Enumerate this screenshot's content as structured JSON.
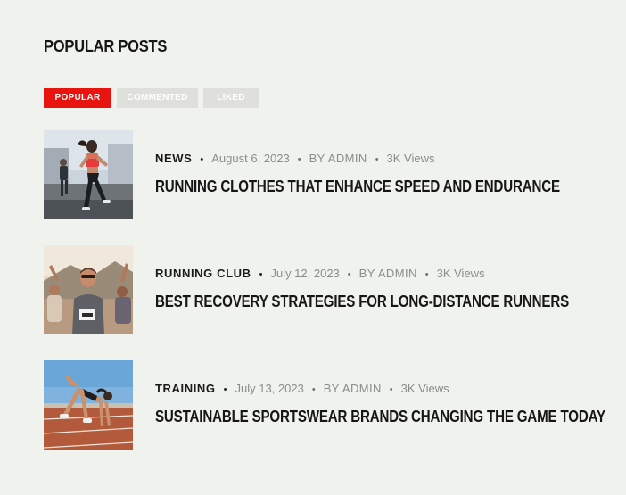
{
  "widget": {
    "title": "POPULAR POSTS"
  },
  "tabs": [
    {
      "label": "POPULAR",
      "active": true
    },
    {
      "label": "COMMENTED",
      "active": false
    },
    {
      "label": "LIKED",
      "active": false
    }
  ],
  "posts": [
    {
      "category": "NEWS",
      "date": "August 6, 2023",
      "author": "BY ADMIN",
      "views": "3K Views",
      "title": "RUNNING CLOTHES THAT ENHANCE SPEED AND ENDURANCE",
      "separator": "•"
    },
    {
      "category": "RUNNING CLUB",
      "date": "July 12, 2023",
      "author": "BY ADMIN",
      "views": "3K Views",
      "title": "BEST RECOVERY STRATEGIES FOR LONG-DISTANCE RUNNERS",
      "separator": "•"
    },
    {
      "category": "TRAINING",
      "date": "July 13, 2023",
      "author": "BY ADMIN",
      "views": "3K Views",
      "title": "SUSTAINABLE SPORTSWEAR BRANDS CHANGING THE GAME TODAY",
      "separator": "•"
    }
  ],
  "colors": {
    "accent": "#e8140f",
    "inactive_tab": "#dfe0dc",
    "background": "#f0f2ee"
  }
}
